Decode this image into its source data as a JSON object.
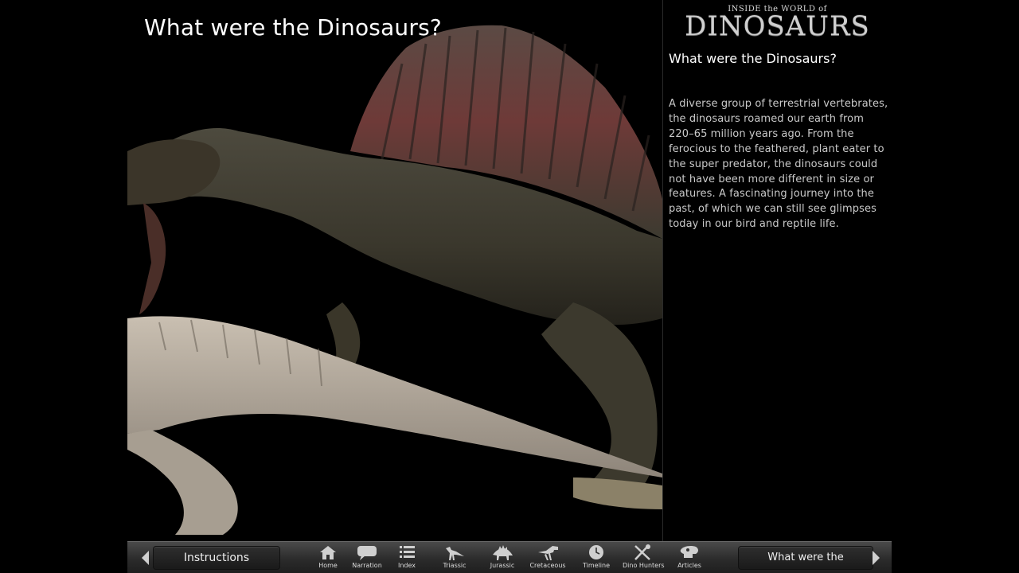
{
  "page": {
    "title": "What were the Dinosaurs?"
  },
  "brand": {
    "top": "INSIDE the WORLD of",
    "main": "DINOSAURS"
  },
  "side": {
    "heading": "What were the Dinosaurs?",
    "body": "A diverse group of terrestrial vertebrates, the dinosaurs roamed our earth from 220–65 million years ago. From the ferocious to the feathered, plant eater to the super predator, the dinosaurs could not have been more different in size or features. A fascinating journey into the past, of which we can still see glimpses today in our bird and reptile life."
  },
  "toolbar": {
    "prev_label": "Instructions",
    "next_label": "What were the Dinosaurs?",
    "items": [
      {
        "label": "Home",
        "icon": "home-icon"
      },
      {
        "label": "Narration",
        "icon": "speech-bubble-icon"
      },
      {
        "label": "Index",
        "icon": "list-icon"
      },
      {
        "label": "Triassic",
        "icon": "triassic-dino-icon"
      },
      {
        "label": "Jurassic",
        "icon": "stegosaurus-icon"
      },
      {
        "label": "Cretaceous",
        "icon": "trex-icon"
      },
      {
        "label": "Timeline",
        "icon": "clock-icon"
      },
      {
        "label": "Dino Hunters",
        "icon": "tools-icon"
      },
      {
        "label": "Articles",
        "icon": "skull-icon"
      }
    ]
  },
  "colors": {
    "background": "#000000",
    "toolbar": "#2b2b2b",
    "text": "#c9c9c9"
  }
}
